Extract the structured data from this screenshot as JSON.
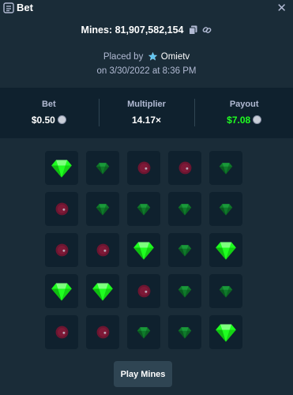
{
  "header": {
    "title": "Bet",
    "close_icon": "close-icon",
    "bet_icon": "bet-receipt-icon"
  },
  "mines": {
    "text": "Mines: 81,907,582,154",
    "copy_icon": "copy-icon",
    "link_icon": "link-icon"
  },
  "placed": {
    "prefix": "Placed by",
    "user": "Omietv",
    "user_icon": "vip-star-icon",
    "date": "on 3/30/2022 at 8:36 PM"
  },
  "stats": {
    "bet_label": "Bet",
    "bet_value": "$0.50",
    "multiplier_label": "Multiplier",
    "multiplier_value": "14.17×",
    "payout_label": "Payout",
    "payout_value": "$7.08",
    "coin_icon": "coin-icon"
  },
  "colors": {
    "background": "#1a2c38",
    "panel": "#0f212e",
    "tile": "#0f212e",
    "gem_bright": "#1fff20",
    "gem_dim": "#0f7a2a",
    "mine_dim": "#6b1530",
    "payout_green": "#1fff20",
    "muted_text": "#b1bad3",
    "button": "#2f4553"
  },
  "grid": [
    [
      "gem-picked",
      "gem",
      "mine",
      "mine",
      "gem"
    ],
    [
      "mine",
      "gem",
      "gem",
      "gem",
      "gem"
    ],
    [
      "mine",
      "mine",
      "gem-picked",
      "gem",
      "gem-picked"
    ],
    [
      "gem-picked",
      "gem-picked",
      "mine",
      "gem",
      "gem"
    ],
    [
      "mine",
      "mine",
      "gem",
      "gem",
      "gem-picked"
    ]
  ],
  "play_button": {
    "label": "Play Mines"
  }
}
